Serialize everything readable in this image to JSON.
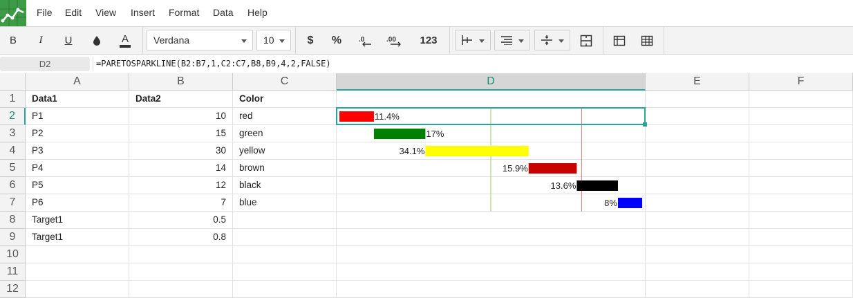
{
  "menu": [
    "File",
    "Edit",
    "View",
    "Insert",
    "Format",
    "Data",
    "Help"
  ],
  "toolbar": {
    "bold": "B",
    "italic": "I",
    "underline": "U",
    "font": "Verdana",
    "size": "10",
    "currency": "$",
    "percent": "%",
    "dec_decrease": ".0",
    "dec_increase": ".00",
    "number_format": "123"
  },
  "formula_bar": {
    "cell_ref": "D2",
    "formula": "=PARETOSPARKLINE(B2:B7,1,C2:C7,B8,B9,4,2,FALSE)"
  },
  "columns": [
    "A",
    "B",
    "C",
    "D",
    "E",
    "F"
  ],
  "active_column": "D",
  "rows": [
    "1",
    "2",
    "3",
    "4",
    "5",
    "6",
    "7",
    "8",
    "9",
    "10",
    "11",
    "12"
  ],
  "active_row": "2",
  "header_row": {
    "a": "Data1",
    "b": "Data2",
    "c": "Color"
  },
  "data_rows": [
    {
      "a": "P1",
      "b": "10",
      "c": "red"
    },
    {
      "a": "P2",
      "b": "15",
      "c": "green"
    },
    {
      "a": "P3",
      "b": "30",
      "c": "yellow"
    },
    {
      "a": "P4",
      "b": "14",
      "c": "brown"
    },
    {
      "a": "P5",
      "b": "12",
      "c": "black"
    },
    {
      "a": "P6",
      "b": "7",
      "c": "blue"
    },
    {
      "a": "Target1",
      "b": "0.5",
      "c": ""
    },
    {
      "a": "Target1",
      "b": "0.8",
      "c": ""
    }
  ],
  "sparkline": {
    "targets": [
      0.5,
      0.8
    ],
    "target_colors": [
      "#9ccc65",
      "#e57373"
    ],
    "bars": [
      {
        "label": "11.4%",
        "value": 0.114,
        "color": "#ff0000",
        "label_side": "right"
      },
      {
        "label": "17%",
        "value": 0.17,
        "color": "#008000",
        "label_side": "right"
      },
      {
        "label": "34.1%",
        "value": 0.341,
        "color": "#ffff00",
        "label_side": "left"
      },
      {
        "label": "15.9%",
        "value": 0.159,
        "color": "#c80000",
        "label_side": "left"
      },
      {
        "label": "13.6%",
        "value": 0.136,
        "color": "#000000",
        "label_side": "left"
      },
      {
        "label": "8%",
        "value": 0.08,
        "color": "#0000ff",
        "label_side": "left"
      }
    ]
  },
  "colors": {
    "accent": "#26a69a",
    "logo": "#3d9a47"
  }
}
